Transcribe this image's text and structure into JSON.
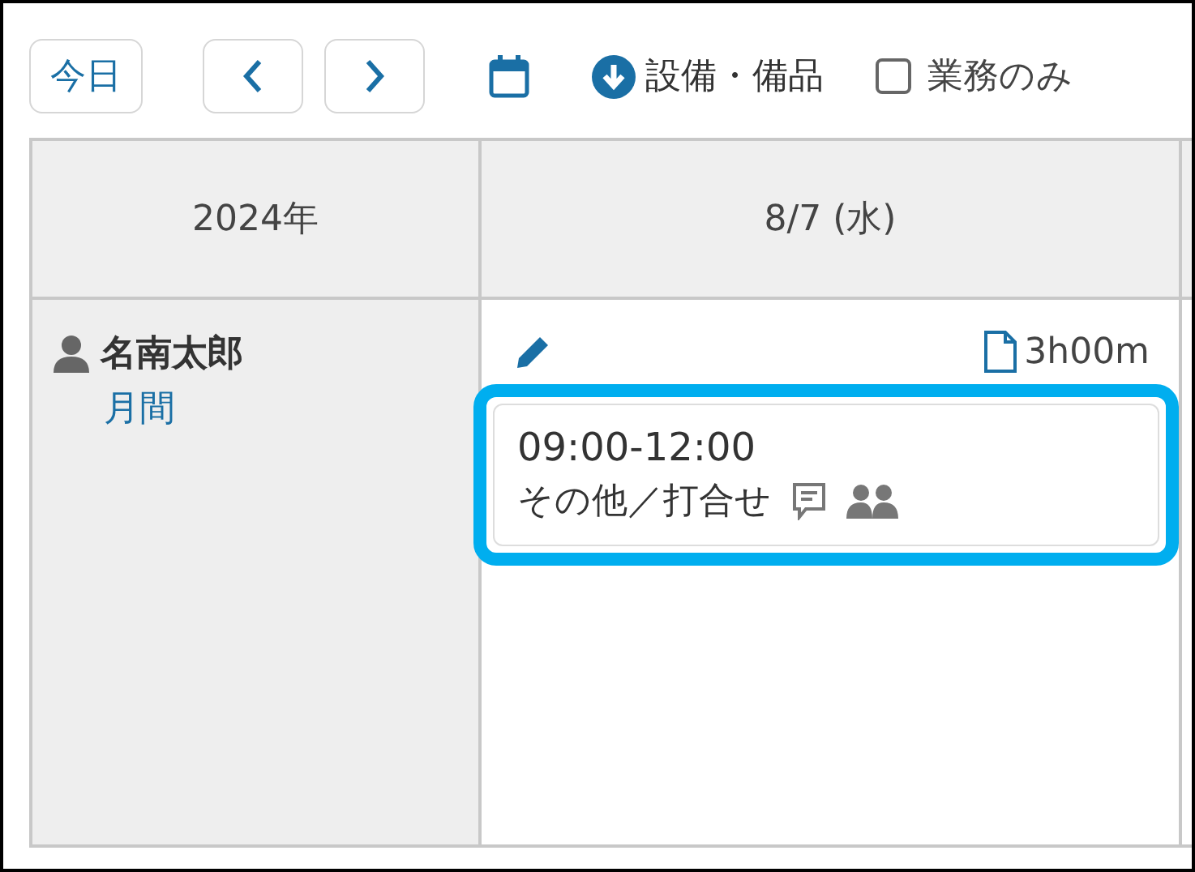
{
  "toolbar": {
    "today_button": "今日",
    "resource_button": "設備・備品",
    "filter_checkbox": {
      "label": "業務のみ",
      "checked": false
    }
  },
  "table": {
    "columns": [
      "2024年",
      "8/7 (水)"
    ],
    "rows": [
      {
        "name": "名南太郎",
        "link": "月間",
        "total": "3h00m",
        "events": [
          {
            "time": "09:00-12:00",
            "title": "その他／打合せ",
            "highlighted": true
          }
        ]
      }
    ]
  }
}
